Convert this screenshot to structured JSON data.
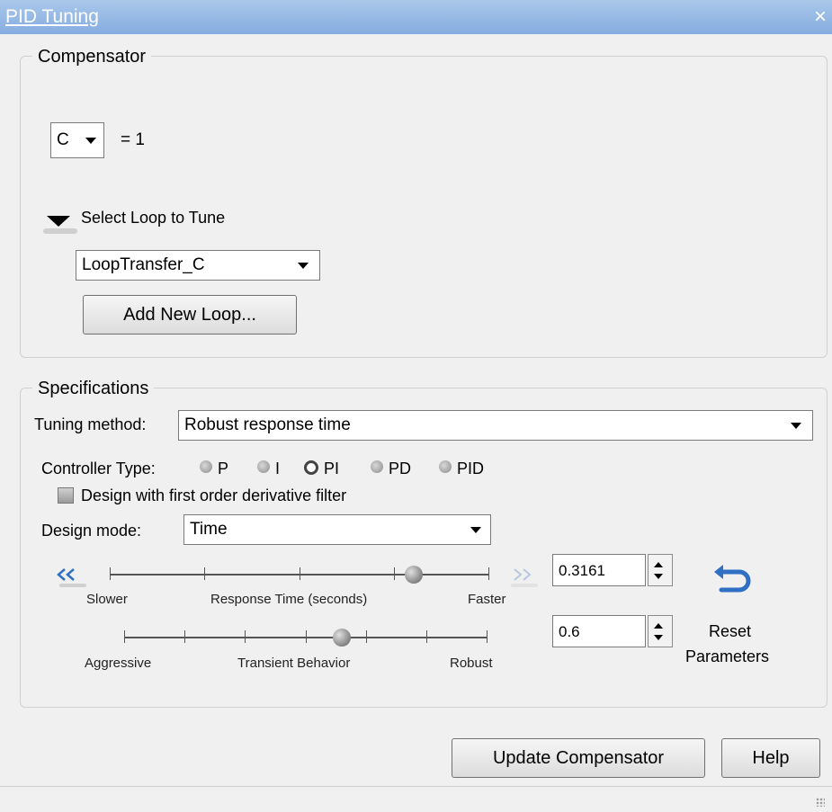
{
  "window": {
    "title": "PID Tuning",
    "close_glyph": "×"
  },
  "compensator": {
    "group_label": "Compensator",
    "selector_value": "C",
    "equation": "= 1",
    "select_loop_label": "Select Loop to Tune",
    "loop_value": "LoopTransfer_C",
    "add_loop_label": "Add New Loop..."
  },
  "specifications": {
    "group_label": "Specifications",
    "tuning_method_label": "Tuning method:",
    "tuning_method_value": "Robust response time",
    "controller_type_label": "Controller Type:",
    "controller_types": [
      "P",
      "I",
      "PI",
      "PD",
      "PID"
    ],
    "selected_controller": "PI",
    "derivative_filter_label": "Design with first order derivative filter",
    "derivative_filter_checked": false,
    "design_mode_label": "Design mode:",
    "design_mode_value": "Time",
    "response_slider": {
      "left_label": "Slower",
      "center_label": "Response Time (seconds)",
      "right_label": "Faster",
      "value": "0.3161",
      "position_fraction": 0.8
    },
    "transient_slider": {
      "left_label": "Aggressive",
      "center_label": "Transient Behavior",
      "right_label": "Robust",
      "value": "0.6",
      "position_fraction": 0.6
    },
    "reset_label_line1": "Reset",
    "reset_label_line2": "Parameters"
  },
  "footer": {
    "update_button": "Update Compensator",
    "help_button": "Help"
  },
  "icons": {
    "close": "close-icon",
    "collapse": "collapse-triangle-icon",
    "slower": "double-chevron-left-icon",
    "faster": "double-chevron-right-icon",
    "reset": "reset-arrow-icon"
  },
  "colors": {
    "titlebar": "#86ace0",
    "background": "#f0f0f0",
    "chevron_active": "#2f6fc4",
    "chevron_inactive": "#b8c8dc"
  }
}
